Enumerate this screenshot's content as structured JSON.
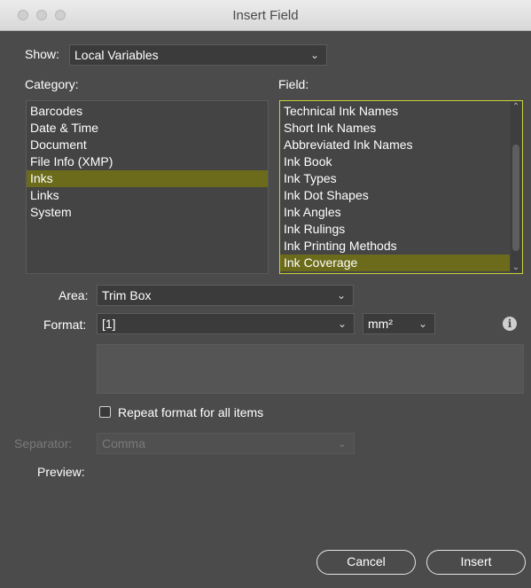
{
  "window": {
    "title": "Insert Field"
  },
  "show": {
    "label": "Show:",
    "value": "Local Variables"
  },
  "category": {
    "label": "Category:",
    "items": [
      "Barcodes",
      "Date & Time",
      "Document",
      "File Info (XMP)",
      "Inks",
      "Links",
      "System"
    ],
    "selected": "Inks"
  },
  "field": {
    "label": "Field:",
    "items": [
      "Technical Ink Names",
      "Short Ink Names",
      "Abbreviated Ink Names",
      "Ink Book",
      "Ink Types",
      "Ink Dot Shapes",
      "Ink Angles",
      "Ink Rulings",
      "Ink Printing Methods",
      "Ink Coverage"
    ],
    "selected": "Ink Coverage"
  },
  "area": {
    "label": "Area:",
    "value": "Trim Box"
  },
  "format": {
    "label": "Format:",
    "value": "[1]",
    "unit": "mm²"
  },
  "repeat": {
    "label": "Repeat format for all items",
    "checked": false
  },
  "separator": {
    "label": "Separator:",
    "value": "Comma"
  },
  "preview": {
    "label": "Preview:"
  },
  "buttons": {
    "cancel": "Cancel",
    "insert": "Insert"
  },
  "icons": {
    "chevron": "chevron-down-icon",
    "info": "info-icon"
  }
}
